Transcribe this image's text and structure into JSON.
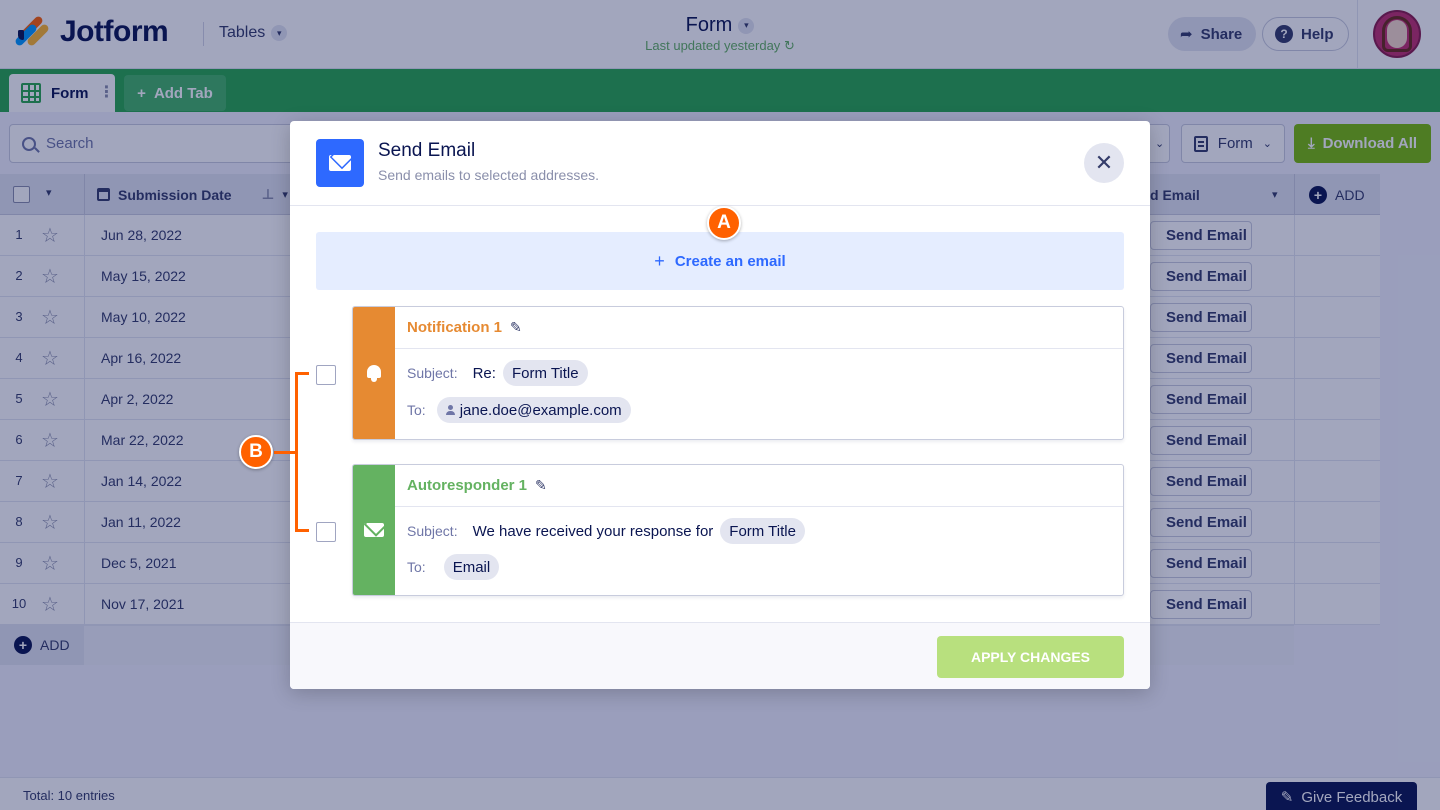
{
  "app": {
    "brand": "Jotform",
    "menu_label": "Tables",
    "form_title": "Form",
    "last_updated": "Last updated yesterday",
    "share_label": "Share",
    "help_label": "Help"
  },
  "tabs": {
    "active": "Form",
    "add": "Add Tab"
  },
  "toolbar": {
    "search_placeholder": "Search",
    "form_dropdown": "Form",
    "download_all": "Download All"
  },
  "table": {
    "headers": {
      "submission_date": "Submission Date",
      "send_email_partial": "d Email",
      "add_column": "ADD"
    },
    "send_button": "Send Email",
    "rows": [
      {
        "n": "1",
        "date": "Jun 28, 2022"
      },
      {
        "n": "2",
        "date": "May 15, 2022"
      },
      {
        "n": "3",
        "date": "May 10, 2022"
      },
      {
        "n": "4",
        "date": "Apr 16, 2022"
      },
      {
        "n": "5",
        "date": "Apr 2, 2022"
      },
      {
        "n": "6",
        "date": "Mar 22, 2022"
      },
      {
        "n": "7",
        "date": "Jan 14, 2022"
      },
      {
        "n": "8",
        "date": "Jan 11, 2022"
      },
      {
        "n": "9",
        "date": "Dec 5, 2021"
      },
      {
        "n": "10",
        "date": "Nov 17, 2021"
      }
    ],
    "add_row": "ADD"
  },
  "footer": {
    "total": "Total: 10 entries",
    "feedback": "Give Feedback"
  },
  "modal": {
    "title": "Send Email",
    "subtitle": "Send emails to selected addresses.",
    "create_email": "Create an email",
    "notification": {
      "name": "Notification 1",
      "subject_label": "Subject:",
      "subject_prefix": "Re:",
      "subject_chip": "Form Title",
      "to_label": "To:",
      "to_chip": "jane.doe@example.com",
      "color": "#e68a32"
    },
    "autoresponder": {
      "name": "Autoresponder 1",
      "subject_label": "Subject:",
      "subject_text": "We have received your response for",
      "subject_chip": "Form Title",
      "to_label": "To:",
      "to_chip": "Email",
      "color": "#64b261"
    },
    "apply": "APPLY CHANGES"
  },
  "annotations": {
    "a": "A",
    "b": "B",
    "color": "#ff6100"
  }
}
